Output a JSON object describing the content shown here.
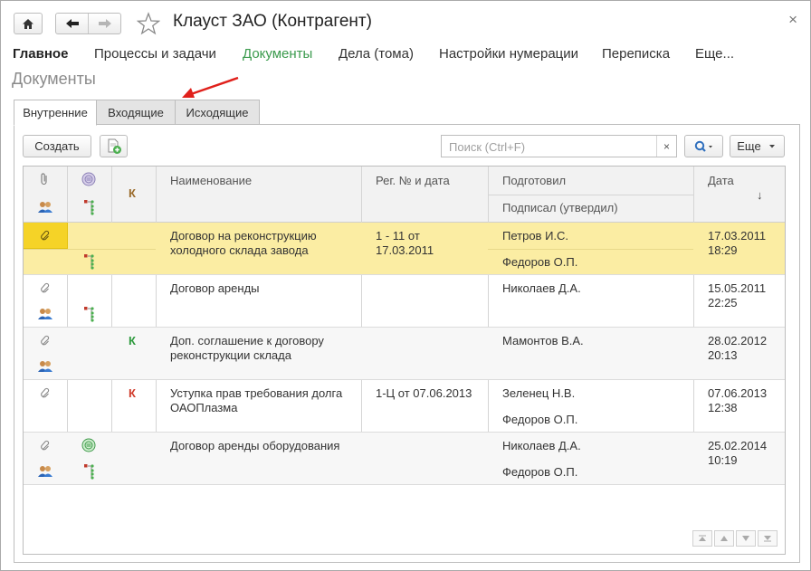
{
  "window": {
    "title": "Клауст ЗАО (Контрагент)",
    "close_glyph": "×"
  },
  "nav": {
    "items": [
      {
        "label": "Главное"
      },
      {
        "label": "Процессы и задачи"
      },
      {
        "label": "Документы"
      },
      {
        "label": "Дела (тома)"
      },
      {
        "label": "Настройки нумерации"
      },
      {
        "label": "Переписка"
      },
      {
        "label": "Еще..."
      }
    ]
  },
  "section_title": "Документы",
  "tabs": [
    {
      "label": "Внутренние"
    },
    {
      "label": "Входящие"
    },
    {
      "label": "Исходящие"
    }
  ],
  "toolbar": {
    "create_label": "Создать",
    "search_placeholder": "Поиск (Ctrl+F)",
    "clear_glyph": "×",
    "more_label": "Еще"
  },
  "table": {
    "headers": {
      "k": "К",
      "name": "Наименование",
      "reg": "Рег. № и дата",
      "prepared": "Подготовил",
      "signed": "Подписал (утвердил)",
      "date": "Дата",
      "sort_glyph": "↓"
    },
    "rows": [
      {
        "name": "Договор на реконструкцию холодного склада завода",
        "reg": "1 - 11 от 17.03.2011",
        "prepared": "Петров И.С.",
        "signed": "Федоров О.П.",
        "date": "17.03.2011",
        "time": "18:29",
        "k": "",
        "k_color": ""
      },
      {
        "name": "Договор аренды",
        "reg": "",
        "prepared": "Николаев Д.А.",
        "signed": "",
        "date": "15.05.2011",
        "time": "22:25",
        "k": "",
        "k_color": ""
      },
      {
        "name": "Доп. соглашение к договору реконструкции склада",
        "reg": "",
        "prepared": "Мамонтов В.А.",
        "signed": "",
        "date": "28.02.2012",
        "time": "20:13",
        "k": "К",
        "k_color": "#2e9a3e"
      },
      {
        "name": "Уступка прав требования долга ОАОПлазма",
        "reg": "1-Ц от 07.06.2013",
        "prepared": "Зеленец Н.В.",
        "signed": "Федоров О.П.",
        "date": "07.06.2013",
        "time": "12:38",
        "k": "К",
        "k_color": "#d03a2a"
      },
      {
        "name": "Договор аренды оборудования",
        "reg": "",
        "prepared": "Николаев Д.А.",
        "signed": "Федоров О.П.",
        "date": "25.02.2014",
        "time": "10:19",
        "k": "",
        "k_color": ""
      }
    ]
  },
  "colors": {
    "accent_green": "#3a9a4c",
    "selected_row": "#fbeda3",
    "arrow_red": "#e0201b"
  }
}
